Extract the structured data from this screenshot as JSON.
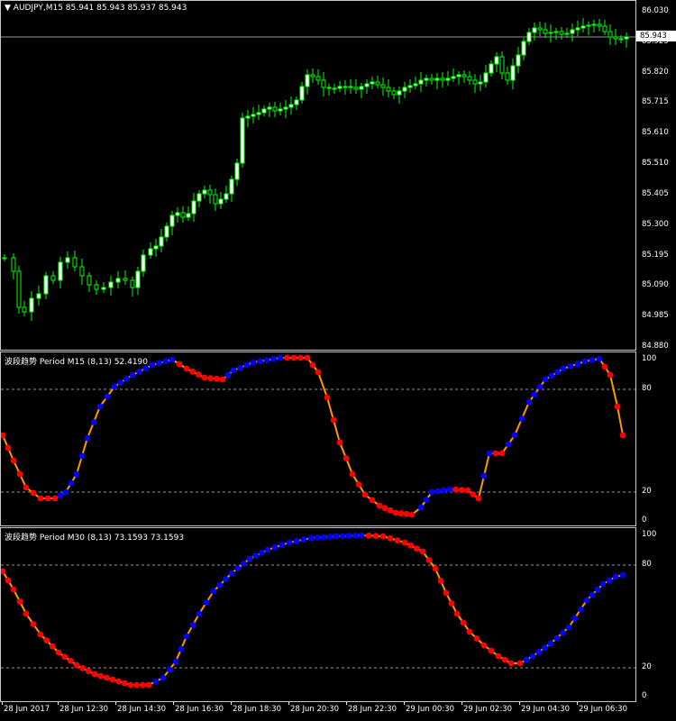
{
  "main_chart": {
    "title": "AUDJPY,M15  85.941 85.943 85.937 85.943",
    "price_levels": [
      "86.030",
      "85.925",
      "85.820",
      "85.715",
      "85.610",
      "85.510",
      "85.405",
      "85.300",
      "85.195",
      "85.090",
      "84.985",
      "84.880"
    ],
    "current_price": "85.943",
    "colors": {
      "bull": "#00ff00",
      "bear": "#ffffff",
      "grid": "#c8c8c8"
    }
  },
  "indicator_m15": {
    "title": "波段趋势 Period M15 (8,13) 52.4190",
    "levels": [
      "100",
      "80",
      "20",
      "0"
    ]
  },
  "indicator_m30": {
    "title": "波段趋势 Period M30 (8,13) 73.1593 73.1593",
    "levels": [
      "100",
      "80",
      "20",
      "0"
    ]
  },
  "time_axis": {
    "labels": [
      "28 Jun 2017",
      "28 Jun 12:30",
      "28 Jun 14:30",
      "28 Jun 16:30",
      "28 Jun 18:30",
      "28 Jun 20:30",
      "28 Jun 22:30",
      "29 Jun 00:30",
      "29 Jun 02:30",
      "29 Jun 04:30",
      "29 Jun 06:30"
    ]
  },
  "indicator_colors": {
    "line": "#ff9900",
    "rising": "#0000ff",
    "falling": "#ff0000",
    "level_line": "#c8c8c8"
  }
}
